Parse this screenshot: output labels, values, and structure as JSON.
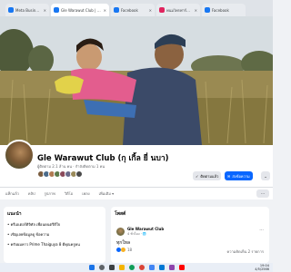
{
  "browser": {
    "tabs": [
      {
        "label": "Meta Business Suite",
        "color": "#1877f2",
        "active": false
      },
      {
        "label": "Gle Warawut Club | Facebook",
        "color": "#1877f2",
        "active": true
      },
      {
        "label": "Facebook",
        "color": "#1877f2",
        "active": false
      },
      {
        "label": "พนมไพรฟาร์มสุข ...",
        "color": "#e0245e",
        "active": false
      },
      {
        "label": "Facebook",
        "color": "#1877f2",
        "active": false
      }
    ]
  },
  "profile": {
    "name": "Gle Warawut Club (กุ เกิ้ล ยี่ นบา)",
    "stats": "ผู้ติดตาม 2.1 ล้าน คน · กำลังติดตาม 1 คน",
    "buttons": {
      "follow": "ติดตามแล้ว",
      "message": "ส่งข้อความ",
      "more": "⌄"
    }
  },
  "nav": {
    "items": [
      "แท็กแล้ว",
      "คลิป",
      "รูปภาพ",
      "วิดีโอ",
      "เพลง",
      "เพิ่มเติม ▾"
    ],
    "more_button": "···"
  },
  "intro": {
    "title": "แนะนำ",
    "lines": [
      "• ครีเอเตอร์ดิจิทัล เพื่อนดนตรีดีใจ",
      "• เชิญเลยข้อมูลดู ข้อความ",
      "• ครับผมคาว Prime Thaiguya 8 ดีคุณครูคน"
    ]
  },
  "post": {
    "section_title": "โพสต์",
    "author": "Gle Warawut Club",
    "time": "4 ชั่วโมง · 🌐",
    "text": "ทุกใหล",
    "reactions": "18",
    "comments": "ความคิดเห็น 2 รายการ"
  },
  "taskbar": {
    "icons": [
      "windows-start-icon",
      "search-icon",
      "task-view-icon",
      "explorer-icon",
      "edge-icon",
      "chrome-icon",
      "store-icon",
      "mail-icon",
      "photos-icon",
      "youtube-icon"
    ],
    "time": "19:04",
    "date": "4/5/2566"
  }
}
